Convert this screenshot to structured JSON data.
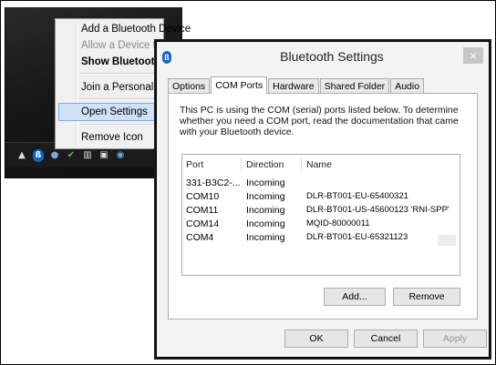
{
  "context_menu": {
    "items": [
      {
        "label": "Add a Bluetooth Device",
        "state": "normal"
      },
      {
        "label": "Allow a Device to",
        "state": "disabled"
      },
      {
        "label": "Show Bluetooth",
        "state": "bold"
      },
      {
        "label": "Join a Personal A",
        "state": "normal"
      },
      {
        "label": "Open Settings",
        "state": "highlighted"
      },
      {
        "label": "Remove Icon",
        "state": "normal"
      }
    ]
  },
  "taskbar": {
    "icons": [
      "chevron-up-icon",
      "bluetooth-icon",
      "network-icon",
      "shield-check-icon",
      "signal-icon",
      "monitor-icon",
      "globe-icon"
    ]
  },
  "dialog": {
    "title": "Bluetooth Settings",
    "close_glyph": "×",
    "tabs": [
      "Options",
      "COM Ports",
      "Hardware",
      "Shared Folder",
      "Audio"
    ],
    "active_tab": "COM Ports",
    "description": "This PC is using the COM (serial) ports listed below. To determine whether you need a COM port, read the documentation that came with your Bluetooth device.",
    "columns": [
      "Port",
      "Direction",
      "Name"
    ],
    "rows": [
      {
        "port": "331-B3C2-...",
        "direction": "Incoming",
        "name": ""
      },
      {
        "port": "COM10",
        "direction": "Incoming",
        "name": "DLR-BT001-EU-65400321"
      },
      {
        "port": "COM11",
        "direction": "Incoming",
        "name": "DLR-BT001-US-45600123 'RNI-SPP'"
      },
      {
        "port": "COM14",
        "direction": "Incoming",
        "name": "MQID-80000011"
      },
      {
        "port": "COM4",
        "direction": "Incoming",
        "name": "DLR-BT001-EU-65321123"
      }
    ],
    "buttons": {
      "add": "Add...",
      "remove": "Remove",
      "ok": "OK",
      "cancel": "Cancel",
      "apply": "Apply"
    }
  }
}
